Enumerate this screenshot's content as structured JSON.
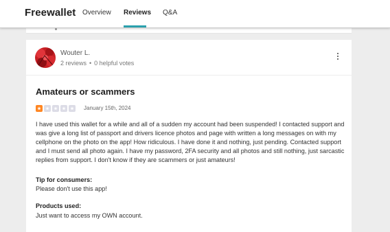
{
  "header": {
    "brand": "Freewallet",
    "tabs": [
      {
        "label": "Overview",
        "active": false
      },
      {
        "label": "Reviews",
        "active": true
      },
      {
        "label": "Q&A",
        "active": false
      }
    ],
    "accent_color": "#2aa0ad"
  },
  "review": {
    "reviewer": {
      "name": "Wouter L.",
      "reviews_count": "2 reviews",
      "separator": "•",
      "helpful_votes": "0 helpful votes",
      "avatar_icon": "red-leaf-avatar"
    },
    "menu_icon": "more-vertical-icon",
    "title": "Amateurs or scammers",
    "rating": 1,
    "rating_max": 5,
    "star_color": "#ff8622",
    "date": "January 15th, 2024",
    "body": "I have used this wallet for a while and all of a sudden my account had been suspended! I contacted support and was give a long list of passport and drivers licence photos and page with written a long messages on with my cellphone on the photo on the app! How ridiculous. I have done it and nothing, just pending. Contacted support and I must send all photo again. I have my password, 2FA security and all photos and still nothing, just sarcastic replies from support. I don't know if they are scammers or just amateurs!",
    "tip_label": "Tip for consumers:",
    "tip_text": "Please don't use this app!",
    "products_label": "Products used:",
    "products_text": "Just want to access my OWN account."
  }
}
